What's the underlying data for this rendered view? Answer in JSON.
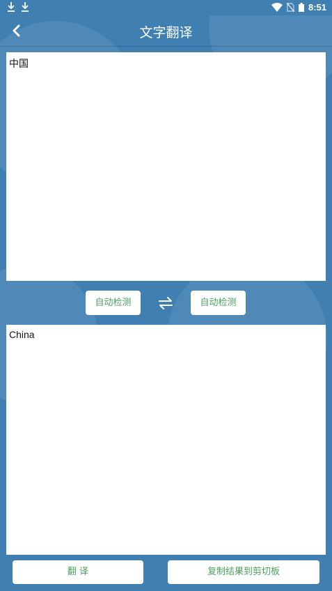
{
  "status_bar": {
    "time": "8:51",
    "icons": [
      "download-icon",
      "download-icon",
      "wifi-icon",
      "no-sim-icon",
      "battery-icon"
    ]
  },
  "header": {
    "title": "文字翻译",
    "back_icon": "back-arrow-icon"
  },
  "source": {
    "text": "中国"
  },
  "languages": {
    "source_label": "自动检测",
    "target_label": "自动检测",
    "swap_icon": "swap-arrows-icon"
  },
  "target": {
    "text": "China"
  },
  "actions": {
    "translate_label": "翻 译",
    "copy_label": "复制结果到剪切板"
  },
  "colors": {
    "background": "#3f7fb1",
    "accent_text": "#4a9f5e",
    "panel": "#ffffff"
  }
}
